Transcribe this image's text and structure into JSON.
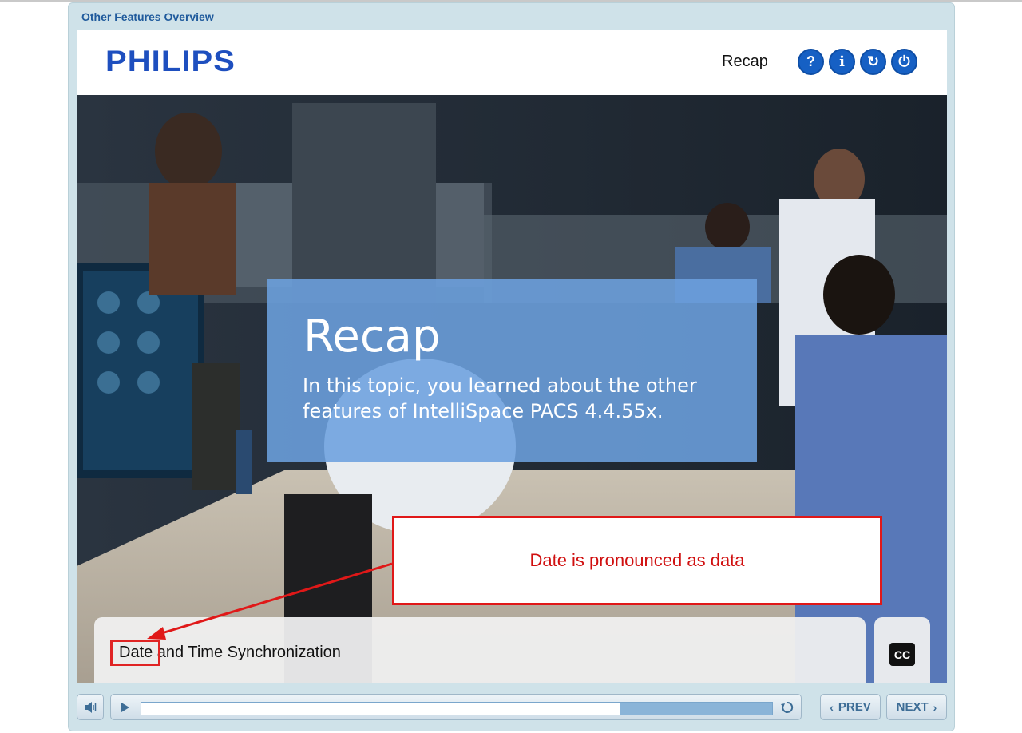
{
  "course": {
    "title": "Other Features Overview"
  },
  "header": {
    "logo_text": "PHILIPS",
    "section_title": "Recap",
    "buttons": [
      {
        "label": "?",
        "icon": "help-icon"
      },
      {
        "label": "i",
        "icon": "info-icon"
      },
      {
        "label": "↻",
        "icon": "restart-icon"
      },
      {
        "label": "⏻",
        "icon": "power-icon"
      }
    ]
  },
  "slide": {
    "title": "Recap",
    "body": "In this topic, you learned about the other features of IntelliSpace PACS 4.4.55x."
  },
  "annotation": {
    "note": "Date is pronounced as data",
    "highlight_color": "#e02424"
  },
  "caption": {
    "text": "Date and Time Synchronization",
    "cc_label": "CC"
  },
  "player": {
    "progress": 0.76,
    "prev_label": "PREV",
    "next_label": "NEXT"
  },
  "colors": {
    "accent": "#1660c4",
    "panel": "#cfe2e9",
    "recap_box": "#6ca0de",
    "annotation": "#e01818"
  }
}
